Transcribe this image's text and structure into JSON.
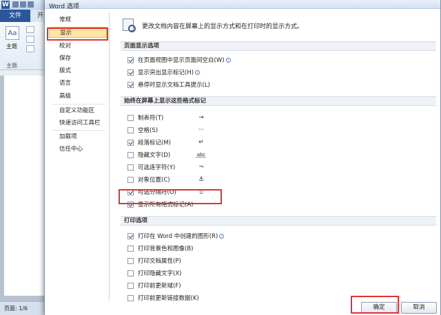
{
  "background_window": {
    "app_icon": "W",
    "file_tab": "文件",
    "partial_tab": "开",
    "theme_label": "主题",
    "theme_group": "主题",
    "status_page": "页面: 1/6"
  },
  "dialog": {
    "title": "Word 选项",
    "nav_items": [
      {
        "label": "常规",
        "selected": false
      },
      {
        "label": "显示",
        "selected": true
      },
      {
        "label": "校对",
        "selected": false
      },
      {
        "label": "保存",
        "selected": false
      },
      {
        "label": "版式",
        "selected": false
      },
      {
        "label": "语言",
        "selected": false
      },
      {
        "label": "高级",
        "selected": false
      },
      {
        "label": "自定义功能区",
        "selected": false
      },
      {
        "label": "快速访问工具栏",
        "selected": false
      },
      {
        "label": "加载项",
        "selected": false
      },
      {
        "label": "信任中心",
        "selected": false
      }
    ],
    "header_text": "更改文档内容在屏幕上的显示方式和在打印时的显示方式。",
    "page_display": {
      "title": "页面显示选项",
      "options": [
        {
          "label": "在页面视图中显示页面间空白(W)",
          "checked": true,
          "info": true
        },
        {
          "label": "显示突出显示标记(H)",
          "checked": true,
          "info": true
        },
        {
          "label": "悬停时显示文档工具提示(L)",
          "checked": true,
          "info": false
        }
      ]
    },
    "format_marks": {
      "title": "始终在屏幕上显示这些格式标记",
      "options": [
        {
          "label": "制表符(T)",
          "checked": false,
          "symbol": "→"
        },
        {
          "label": "空格(S)",
          "checked": false,
          "symbol": "···"
        },
        {
          "label": "段落标记(M)",
          "checked": true,
          "symbol": "↵"
        },
        {
          "label": "隐藏文字(D)",
          "checked": false,
          "symbol": "abc"
        },
        {
          "label": "可选连字符(Y)",
          "checked": false,
          "symbol": "¬"
        },
        {
          "label": "对象位置(C)",
          "checked": false,
          "symbol": "⚓"
        },
        {
          "label": "可选分隔符(O)",
          "checked": true,
          "symbol": "▯"
        },
        {
          "label": "显示所有格式标记(A)",
          "checked": true,
          "symbol": ""
        }
      ]
    },
    "print": {
      "title": "打印选项",
      "options": [
        {
          "label": "打印在 Word 中创建的图形(R)",
          "checked": true,
          "info": true
        },
        {
          "label": "打印背景色和图像(B)",
          "checked": false,
          "info": false
        },
        {
          "label": "打印文档属性(P)",
          "checked": false,
          "info": false
        },
        {
          "label": "打印隐藏文字(X)",
          "checked": false,
          "info": false
        },
        {
          "label": "打印前更新域(F)",
          "checked": false,
          "info": false
        },
        {
          "label": "打印前更新链接数据(K)",
          "checked": false,
          "info": false
        }
      ]
    },
    "ok_label": "确定",
    "cancel_label": "取消"
  },
  "colors": {
    "highlight_red": "#e0322e",
    "nav_selected": "#fde6a2",
    "file_tab": "#2b579a"
  }
}
